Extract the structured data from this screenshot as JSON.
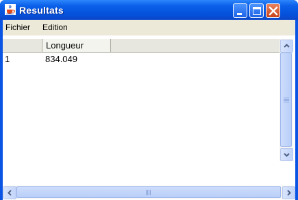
{
  "window": {
    "title": "Resultats"
  },
  "menu": {
    "items": [
      "Fichier",
      "Edition"
    ]
  },
  "table": {
    "columns": [
      "",
      "Longueur"
    ],
    "rows": [
      {
        "index": "1",
        "value": "834.049"
      }
    ]
  },
  "colors": {
    "titlebar": "#0a55e3",
    "menubar": "#ece9d8",
    "close": "#c9421b"
  },
  "icons": {
    "app": "java-coffee-cup-icon",
    "minimize": "minimize-icon",
    "maximize": "maximize-icon",
    "close": "close-icon"
  }
}
